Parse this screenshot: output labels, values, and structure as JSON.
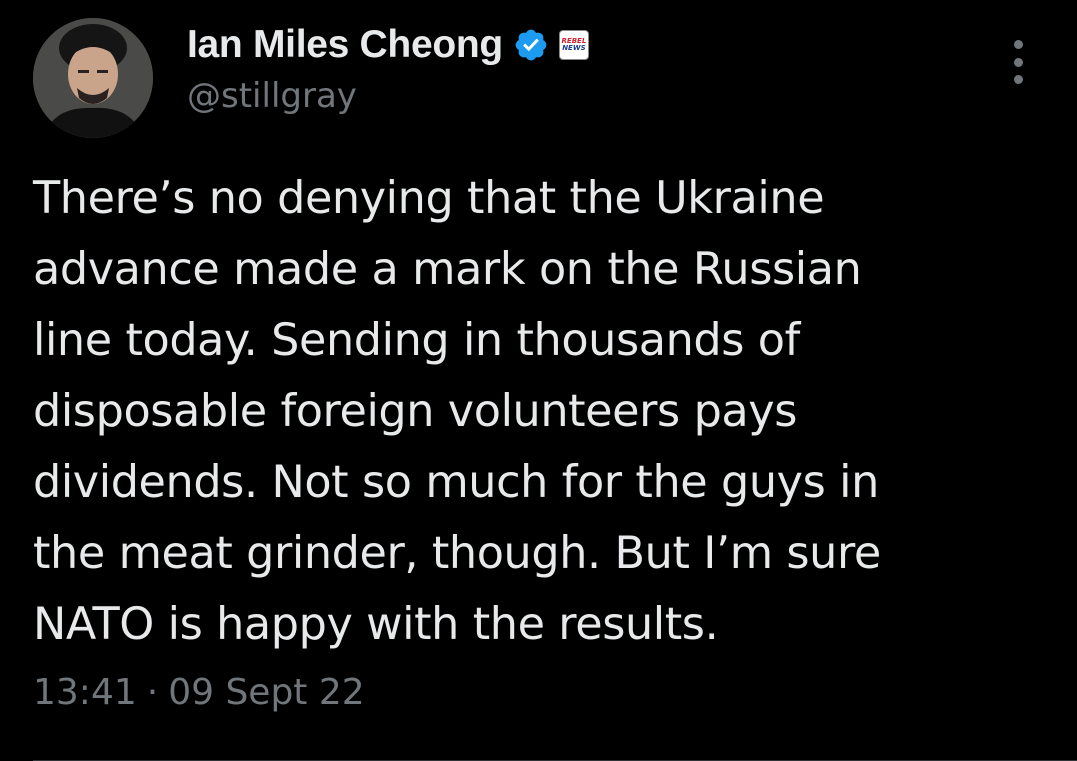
{
  "colors": {
    "background": "#000000",
    "primary_text": "#e7e9ea",
    "secondary_text": "#71767b",
    "verified_badge": "#1d9bf0",
    "affiliate_brand": "#d3202e"
  },
  "author": {
    "display_name": "Ian Miles Cheong",
    "handle": "@stillgray",
    "verified_icon": "verified-badge-icon",
    "affiliate_badge": {
      "line1": "REBEL",
      "line2": "NEWS"
    },
    "avatar_icon": "profile-photo"
  },
  "tweet": {
    "text_lines": [
      "There’s no denying that the Ukraine",
      "advance made a mark on the Russian",
      "line today. Sending in thousands of",
      "disposable foreign volunteers pays",
      "dividends. Not so much for the guys in",
      "the meat grinder, though. But I’m sure",
      "NATO is happy with the results."
    ],
    "time": "13:41",
    "separator": "·",
    "date": "09 Sept 22"
  },
  "menu": {
    "more_icon": "more-vertical-icon"
  }
}
